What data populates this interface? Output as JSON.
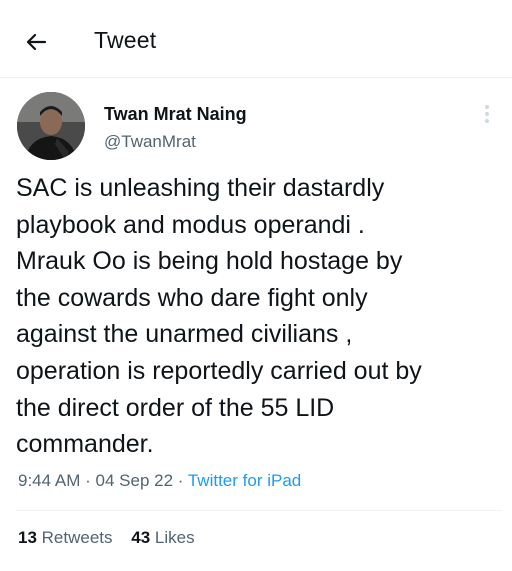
{
  "header": {
    "title": "Tweet",
    "back_icon": "arrow-left-icon"
  },
  "author": {
    "display_name": "Twan Mrat Naing",
    "handle": "@TwanMrat",
    "avatar_icon": "user-avatar"
  },
  "tweet": {
    "text": "SAC is unleashing their dastardly\nplaybook and modus operandi .\nMrauk Oo is being hold hostage by\nthe cowards who dare fight only\nagainst the unarmed civilians ,\noperation is reportedly carried out by\nthe direct order of the 55 LID\ncommander.",
    "time": "9:44 AM",
    "separator": "·",
    "date": "04 Sep 22",
    "source": "Twitter for iPad"
  },
  "stats": {
    "retweets_count": "13",
    "retweets_label": "Retweets",
    "likes_count": "43",
    "likes_label": "Likes"
  },
  "colors": {
    "accent": "#1d9bf0",
    "secondary_text": "#536471",
    "primary_text": "#0f1419"
  }
}
